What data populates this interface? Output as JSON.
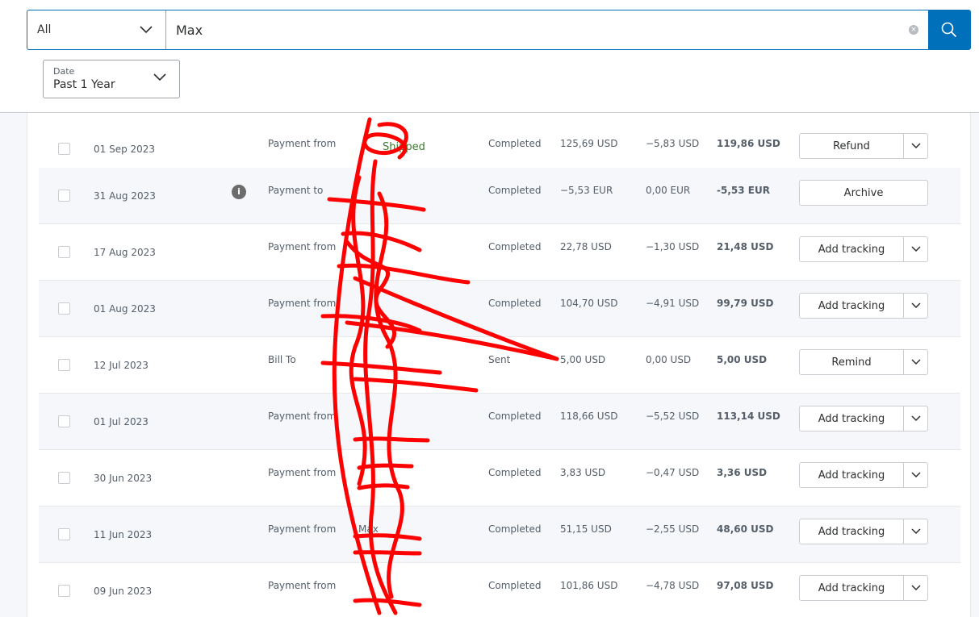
{
  "search": {
    "category": "All",
    "query": "Max",
    "clear_label": "×"
  },
  "date_filter": {
    "caption": "Date",
    "value": "Past 1 Year"
  },
  "transactions": [
    {
      "date": "01 Sep 2023",
      "type": "Payment from",
      "name": "",
      "status": "Completed",
      "gross": "125,69 USD",
      "fee": "−5,83 USD",
      "net": "119,86 USD",
      "action": "Refund",
      "has_dropdown": true,
      "has_info": false,
      "extra": "Shipped"
    },
    {
      "date": "31 Aug 2023",
      "type": "Payment to",
      "name": "",
      "status": "Completed",
      "gross": "−5,53 EUR",
      "fee": "0,00 EUR",
      "net": "-5,53 EUR",
      "action": "Archive",
      "has_dropdown": false,
      "has_info": true,
      "extra": ""
    },
    {
      "date": "17 Aug 2023",
      "type": "Payment from",
      "name": "",
      "status": "Completed",
      "gross": "22,78 USD",
      "fee": "−1,30 USD",
      "net": "21,48 USD",
      "action": "Add tracking",
      "has_dropdown": true,
      "has_info": false,
      "extra": ""
    },
    {
      "date": "01 Aug 2023",
      "type": "Payment from",
      "name": "",
      "status": "Completed",
      "gross": "104,70 USD",
      "fee": "−4,91 USD",
      "net": "99,79 USD",
      "action": "Add tracking",
      "has_dropdown": true,
      "has_info": false,
      "extra": ""
    },
    {
      "date": "12 Jul 2023",
      "type": "Bill To",
      "name": "",
      "status": "Sent",
      "gross": "5,00 USD",
      "fee": "0,00 USD",
      "net": "5,00 USD",
      "action": "Remind",
      "has_dropdown": true,
      "has_info": false,
      "extra": ""
    },
    {
      "date": "01 Jul 2023",
      "type": "Payment from",
      "name": "",
      "status": "Completed",
      "gross": "118,66 USD",
      "fee": "−5,52 USD",
      "net": "113,14 USD",
      "action": "Add tracking",
      "has_dropdown": true,
      "has_info": false,
      "extra": ""
    },
    {
      "date": "30 Jun 2023",
      "type": "Payment from",
      "name": "",
      "status": "Completed",
      "gross": "3,83 USD",
      "fee": "−0,47 USD",
      "net": "3,36 USD",
      "action": "Add tracking",
      "has_dropdown": true,
      "has_info": false,
      "extra": ""
    },
    {
      "date": "11 Jun 2023",
      "type": "Payment from",
      "name": "Max",
      "status": "Completed",
      "gross": "51,15 USD",
      "fee": "−2,55 USD",
      "net": "48,60 USD",
      "action": "Add tracking",
      "has_dropdown": true,
      "has_info": false,
      "extra": ""
    },
    {
      "date": "09 Jun 2023",
      "type": "Payment from",
      "name": "",
      "status": "Completed",
      "gross": "101,86 USD",
      "fee": "−4,78 USD",
      "net": "97,08 USD",
      "action": "Add tracking",
      "has_dropdown": true,
      "has_info": false,
      "extra": ""
    }
  ],
  "colors": {
    "accent": "#0070ba",
    "redaction": "#ff0000",
    "shipped": "#3a7a2f"
  },
  "icons": {
    "search": "search-icon",
    "chevron": "chevron-down-icon",
    "info": "info-icon",
    "clear": "clear-icon"
  }
}
